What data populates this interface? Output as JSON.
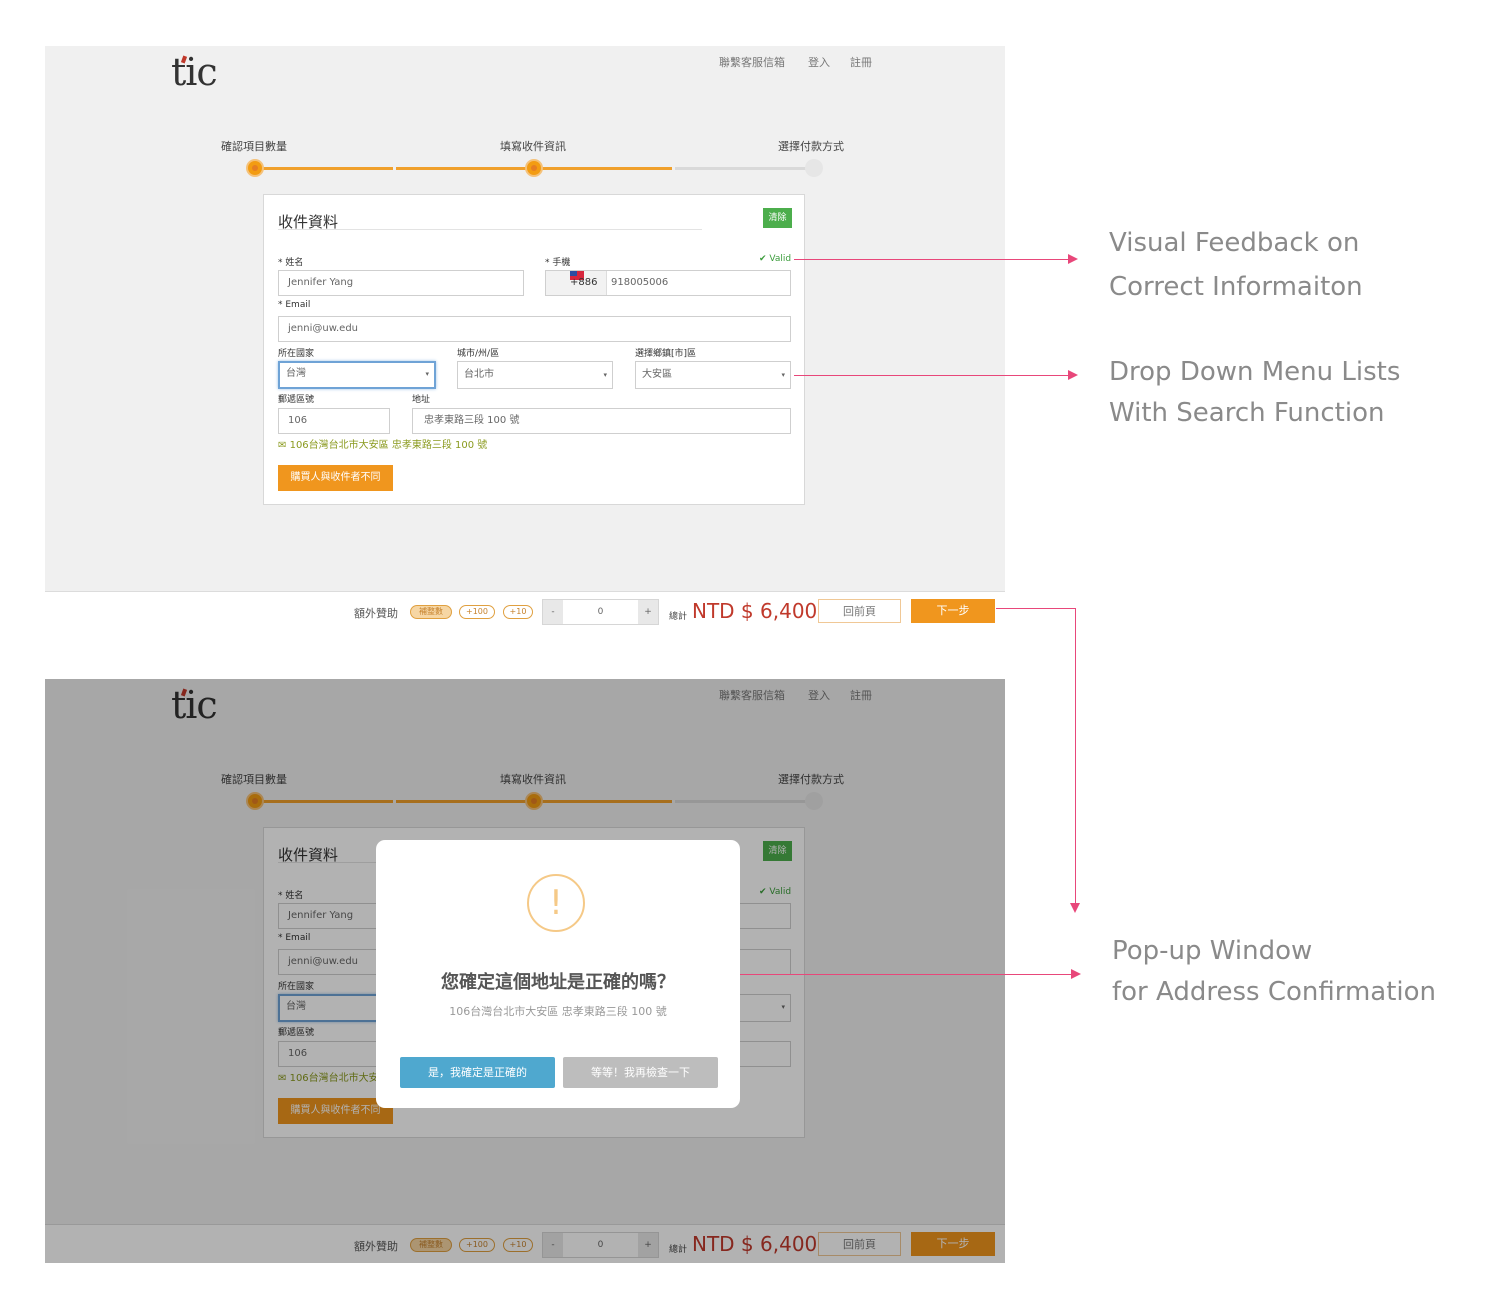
{
  "app": {
    "logo": "tic"
  },
  "nav": {
    "contact": "聯繫客服信箱",
    "login": "登入",
    "register": "註冊"
  },
  "steps": [
    {
      "label": "確認項目數量",
      "state": "done"
    },
    {
      "label": "填寫收件資訊",
      "state": "done"
    },
    {
      "label": "選擇付款方式",
      "state": "todo"
    }
  ],
  "form": {
    "title": "收件資料",
    "clear_label": "清除",
    "name_label": "* 姓名",
    "name_value": "Jennifer Yang",
    "phone_label": "* 手機",
    "phone_code": "+886",
    "phone_value": "918005006",
    "valid_text": "✔ Valid",
    "email_label": "* Email",
    "email_value": "jenni@uw.edu",
    "country_label": "所在國家",
    "country_value": "台灣",
    "city_label": "城市/州/區",
    "city_value": "台北市",
    "district_label": "選擇鄉鎮[市]區",
    "district_value": "大安區",
    "zip_label": "郵遞區號",
    "zip_value": "106",
    "address_label": "地址",
    "address_value": "忠孝東路三段 100 號",
    "address_preview": "106台灣台北市大安區 忠孝東路三段 100 號",
    "buyer_button": "購買人與收件者不同"
  },
  "footer": {
    "extra_label": "額外贊助",
    "pill_round": "補整數",
    "pill_100": "+100",
    "pill_10": "+10",
    "minus": "-",
    "plus": "+",
    "qty": "0",
    "total_label": "總計",
    "total_value": "NTD $ 6,400",
    "back_label": "回前頁",
    "next_label": "下一步"
  },
  "modal": {
    "icon": "!",
    "title": "您確定這個地址是正確的嗎？",
    "address": "106台灣台北市大安區 忠孝東路三段 100 號",
    "confirm_label": "是，我確定是正確的",
    "recheck_label": "等等！我再檢查一下"
  },
  "annotations": {
    "a1_line1": "Visual Feedback on",
    "a1_line2": "Correct Informaiton",
    "a2_line1": "Drop Down Menu Lists",
    "a2_line2": "With Search Function",
    "a3_line1": "Pop-up Window",
    "a3_line2": "for Address Confirmation"
  },
  "colors": {
    "accent": "#f0961e",
    "arrow": "#e8477a",
    "valid": "#3c9d3c",
    "total": "#c0392b",
    "confirm": "#4fa8cf"
  }
}
